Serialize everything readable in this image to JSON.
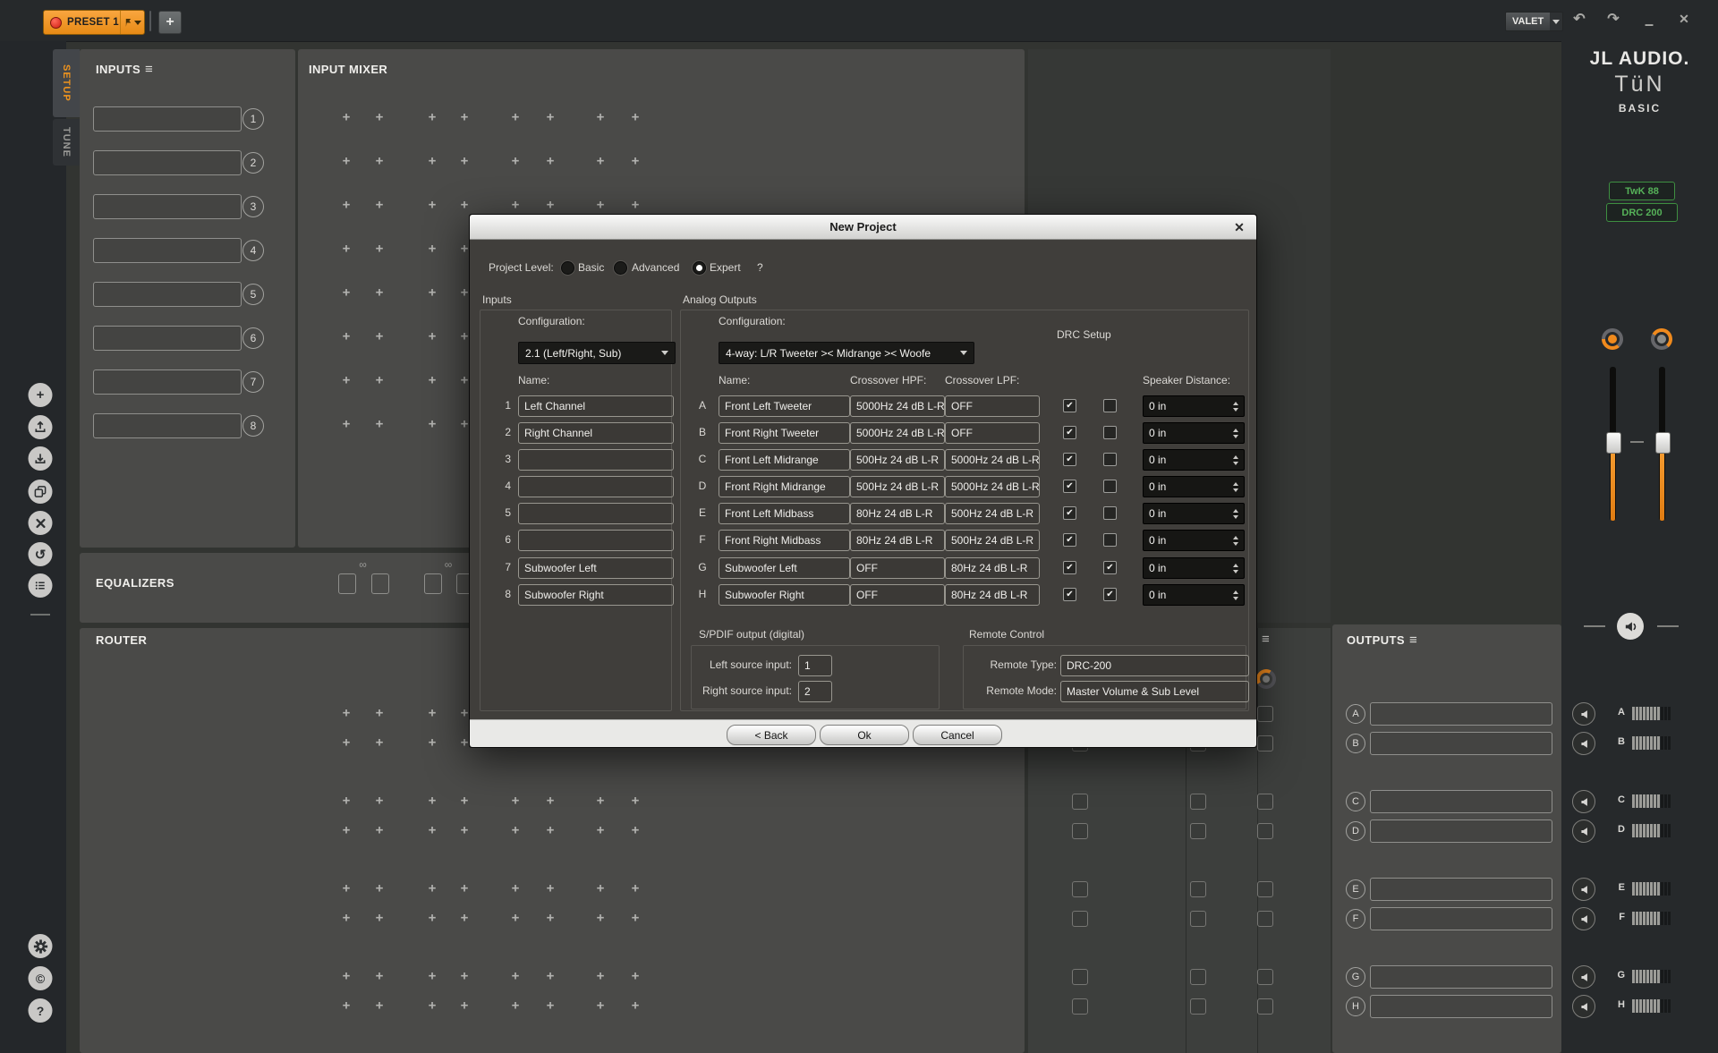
{
  "topbar": {
    "preset": "PRESET 1",
    "valet": "VALET"
  },
  "icons": {
    "burger": "≡",
    "close": "✕",
    "undo": "↶",
    "redo": "↷",
    "minimize": "–",
    "plus": "+",
    "help": "?",
    "copyright": "©",
    "reset": "↺",
    "infinity": "∞",
    "check": "✔"
  },
  "side_tabs": {
    "setup": "SETUP",
    "tune": "TUNE"
  },
  "brand": {
    "line1": "JL AUDIO.",
    "line2": "TüN",
    "line3": "BASIC",
    "devices": [
      {
        "label": "TwK 88"
      },
      {
        "label": "DRC 200"
      }
    ]
  },
  "colors": {
    "accent_orange": "#f08a1d",
    "preset_orange": "#f0941f",
    "status_red": "#d9291c",
    "device_green": "#4cae4f"
  },
  "panels": {
    "inputs": {
      "title": "INPUTS",
      "rows": [
        {
          "num": "1",
          "value": ""
        },
        {
          "num": "2",
          "value": ""
        },
        {
          "num": "3",
          "value": ""
        },
        {
          "num": "4",
          "value": ""
        },
        {
          "num": "5",
          "value": ""
        },
        {
          "num": "6",
          "value": ""
        },
        {
          "num": "7",
          "value": ""
        },
        {
          "num": "8",
          "value": ""
        }
      ]
    },
    "input_mixer": {
      "title": "INPUT MIXER"
    },
    "equalizers": {
      "title": "EQUALIZERS"
    },
    "router": {
      "title": "ROUTER"
    },
    "outputs": {
      "title": "OUTPUTS",
      "rows": [
        {
          "ch": "A",
          "value": ""
        },
        {
          "ch": "B",
          "value": ""
        },
        {
          "ch": "C",
          "value": ""
        },
        {
          "ch": "D",
          "value": ""
        },
        {
          "ch": "E",
          "value": ""
        },
        {
          "ch": "F",
          "value": ""
        },
        {
          "ch": "G",
          "value": ""
        },
        {
          "ch": "H",
          "value": ""
        }
      ]
    },
    "meters": {
      "rows": [
        {
          "ch": "A",
          "segments_total": 11,
          "segments_lit": 8
        },
        {
          "ch": "B",
          "segments_total": 11,
          "segments_lit": 8
        },
        {
          "ch": "C",
          "segments_total": 11,
          "segments_lit": 8
        },
        {
          "ch": "D",
          "segments_total": 11,
          "segments_lit": 8
        },
        {
          "ch": "E",
          "segments_total": 11,
          "segments_lit": 8
        },
        {
          "ch": "F",
          "segments_total": 11,
          "segments_lit": 8
        },
        {
          "ch": "G",
          "segments_total": 11,
          "segments_lit": 8
        },
        {
          "ch": "H",
          "segments_total": 11,
          "segments_lit": 8
        }
      ]
    }
  },
  "dialog": {
    "title": "New Project",
    "project_level": {
      "label": "Project Level:",
      "options": [
        "Basic",
        "Advanced",
        "Expert"
      ],
      "selected": "Expert",
      "help": "?"
    },
    "inputs_group": {
      "title": "Inputs",
      "config_label": "Configuration:",
      "config_value": "2.1 (Left/Right, Sub)",
      "name_header": "Name:",
      "rows": [
        {
          "num": "1",
          "name": "Left Channel"
        },
        {
          "num": "2",
          "name": "Right Channel"
        },
        {
          "num": "3",
          "name": ""
        },
        {
          "num": "4",
          "name": ""
        },
        {
          "num": "5",
          "name": ""
        },
        {
          "num": "6",
          "name": ""
        },
        {
          "num": "7",
          "name": "Subwoofer Left"
        },
        {
          "num": "8",
          "name": "Subwoofer Right"
        }
      ]
    },
    "outputs_group": {
      "title": "Analog Outputs",
      "config_label": "Configuration:",
      "config_value": "4-way: L/R Tweeter >< Midrange >< Woofe",
      "drc_setup_label": "DRC Setup",
      "headers": {
        "name": "Name:",
        "hpf": "Crossover HPF:",
        "lpf": "Crossover LPF:",
        "distance": "Speaker Distance:"
      },
      "rows": [
        {
          "ch": "A",
          "name": "Front Left Tweeter",
          "hpf": "5000Hz 24 dB L-R",
          "lpf": "OFF",
          "drc1": true,
          "drc2": false,
          "dist": "0 in"
        },
        {
          "ch": "B",
          "name": "Front Right Tweeter",
          "hpf": "5000Hz 24 dB L-R",
          "lpf": "OFF",
          "drc1": true,
          "drc2": false,
          "dist": "0 in"
        },
        {
          "ch": "C",
          "name": "Front Left Midrange",
          "hpf": "500Hz 24 dB L-R",
          "lpf": "5000Hz 24 dB L-R",
          "drc1": true,
          "drc2": false,
          "dist": "0 in"
        },
        {
          "ch": "D",
          "name": "Front Right Midrange",
          "hpf": "500Hz 24 dB L-R",
          "lpf": "5000Hz 24 dB L-R",
          "drc1": true,
          "drc2": false,
          "dist": "0 in"
        },
        {
          "ch": "E",
          "name": "Front Left Midbass",
          "hpf": "80Hz 24 dB L-R",
          "lpf": "500Hz 24 dB L-R",
          "drc1": true,
          "drc2": false,
          "dist": "0 in"
        },
        {
          "ch": "F",
          "name": "Front Right Midbass",
          "hpf": "80Hz 24 dB L-R",
          "lpf": "500Hz 24 dB L-R",
          "drc1": true,
          "drc2": false,
          "dist": "0 in"
        },
        {
          "ch": "G",
          "name": "Subwoofer Left",
          "hpf": "OFF",
          "lpf": "80Hz 24 dB L-R",
          "drc1": true,
          "drc2": true,
          "dist": "0 in"
        },
        {
          "ch": "H",
          "name": "Subwoofer Right",
          "hpf": "OFF",
          "lpf": "80Hz 24 dB L-R",
          "drc1": true,
          "drc2": true,
          "dist": "0 in"
        }
      ]
    },
    "spdif_group": {
      "title": "S/PDIF output (digital)",
      "left_label": "Left source input:",
      "left_value": "1",
      "right_label": "Right source input:",
      "right_value": "2"
    },
    "remote_group": {
      "title": "Remote Control",
      "type_label": "Remote Type:",
      "type_value": "DRC-200",
      "mode_label": "Remote Mode:",
      "mode_value": "Master Volume & Sub Level"
    },
    "buttons": {
      "back": "< Back",
      "ok": "Ok",
      "cancel": "Cancel"
    }
  }
}
